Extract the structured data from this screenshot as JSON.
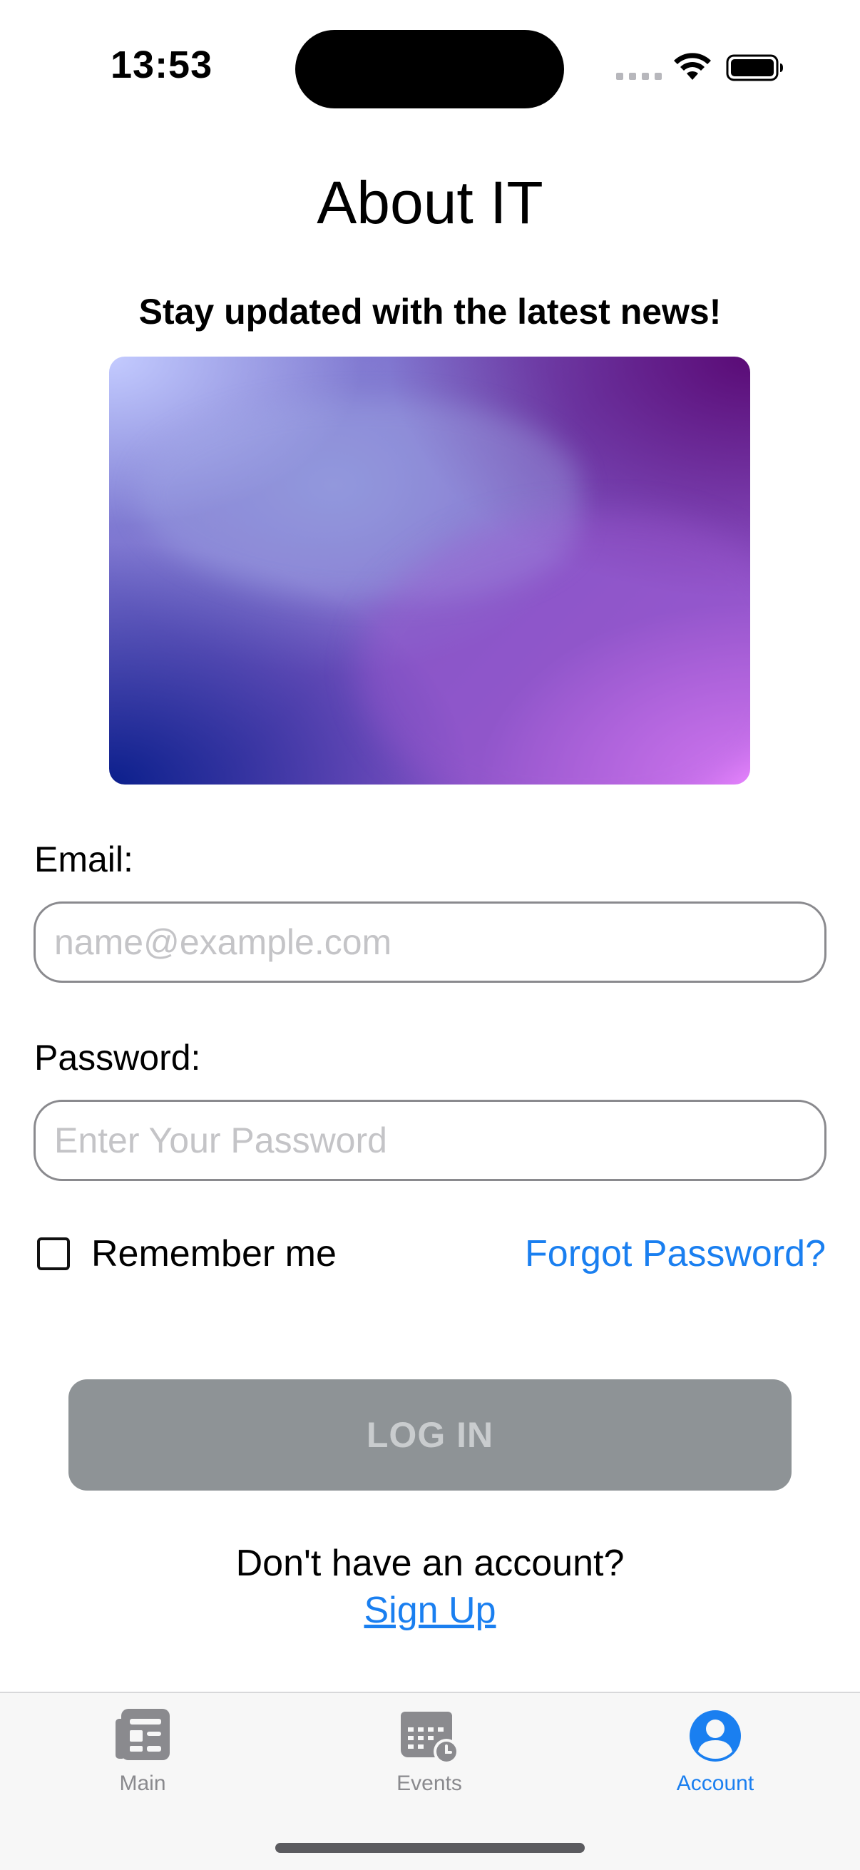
{
  "status_bar": {
    "time": "13:53"
  },
  "page": {
    "title": "About IT",
    "subtitle": "Stay updated with the latest news!"
  },
  "form": {
    "email_label": "Email:",
    "email_placeholder": "name@example.com",
    "email_value": "",
    "password_label": "Password:",
    "password_placeholder": "Enter Your Password",
    "password_value": "",
    "remember_label": "Remember me",
    "remember_checked": false,
    "forgot_label": "Forgot Password?",
    "login_label": "LOG IN",
    "no_account_text": "Don't have an account?",
    "signup_label": "Sign Up"
  },
  "tabbar": {
    "items": [
      {
        "label": "Main",
        "icon": "newspaper-icon",
        "active": false
      },
      {
        "label": "Events",
        "icon": "calendar-clock-icon",
        "active": false
      },
      {
        "label": "Account",
        "icon": "person-circle-icon",
        "active": true
      }
    ]
  },
  "colors": {
    "accent": "#1a7ff0",
    "button_disabled": "#8e9396",
    "button_text_disabled": "#c9ccce",
    "inactive_tab": "#8a8a8e"
  }
}
